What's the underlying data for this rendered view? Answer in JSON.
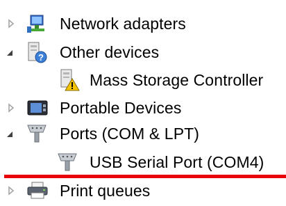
{
  "tree": {
    "items": [
      {
        "label": "Network adapters",
        "state": "collapsed",
        "icon": "network-adapter-icon"
      },
      {
        "label": "Other devices",
        "state": "expanded",
        "icon": "unknown-device-icon"
      },
      {
        "label": "Mass Storage Controller",
        "state": "leaf",
        "icon": "warning-device-icon"
      },
      {
        "label": "Portable Devices",
        "state": "collapsed",
        "icon": "portable-device-icon"
      },
      {
        "label": "Ports (COM & LPT)",
        "state": "expanded",
        "icon": "port-icon"
      },
      {
        "label": "USB Serial Port (COM4)",
        "state": "leaf",
        "icon": "port-icon"
      },
      {
        "label": "Print queues",
        "state": "collapsed",
        "icon": "printer-icon"
      }
    ]
  },
  "colors": {
    "highlight_line": "#e8000b",
    "arrow_gray": "#a6a6a6",
    "arrow_dark": "#404040",
    "warning": "#f5c400"
  }
}
